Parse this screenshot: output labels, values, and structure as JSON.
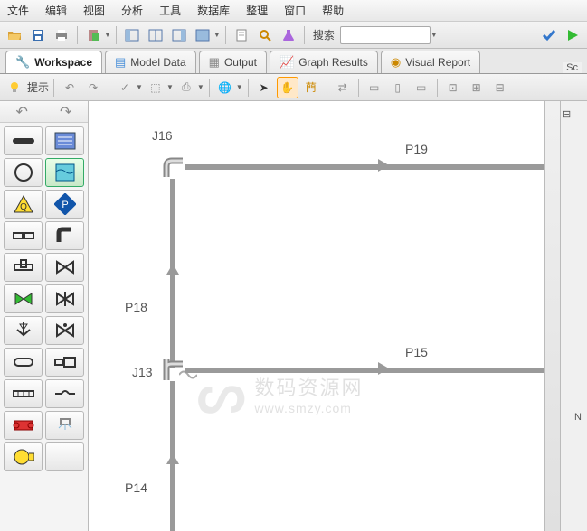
{
  "menu": {
    "items": [
      "文件",
      "编辑",
      "视图",
      "分析",
      "工具",
      "数据库",
      "整理",
      "窗口",
      "帮助"
    ]
  },
  "toolbar": {
    "search_label": "搜索"
  },
  "tabs": [
    {
      "label": "Workspace",
      "icon": "wrench-icon",
      "active": true
    },
    {
      "label": "Model Data",
      "icon": "database-icon",
      "active": false
    },
    {
      "label": "Output",
      "icon": "grid-icon",
      "active": false
    },
    {
      "label": "Graph Results",
      "icon": "chart-icon",
      "active": false
    },
    {
      "label": "Visual Report",
      "icon": "eye-icon",
      "active": false
    }
  ],
  "subtoolbar": {
    "hint_label": "提示"
  },
  "rightside": {
    "panel1": "Sc",
    "panel2": "N"
  },
  "diagram": {
    "junctions": {
      "j16": "J16",
      "j13": "J13"
    },
    "pipes": {
      "p19": "P19",
      "p18": "P18",
      "p15": "P15",
      "p14": "P14"
    }
  },
  "watermark": {
    "line1": "数码资源网",
    "line2": "www.smzy.com"
  },
  "palette_icons": [
    "component-pipe",
    "component-notes",
    "component-circle",
    "component-reservoir",
    "component-pump-q",
    "component-pump-p",
    "component-joint-l",
    "component-elbow",
    "component-tee",
    "component-valve",
    "component-check-l",
    "component-check-r",
    "component-regulator",
    "component-valve2",
    "component-cap",
    "component-expansion",
    "component-manifold",
    "component-skip",
    "component-heater",
    "component-spray",
    "component-compressor",
    "component-blank"
  ]
}
